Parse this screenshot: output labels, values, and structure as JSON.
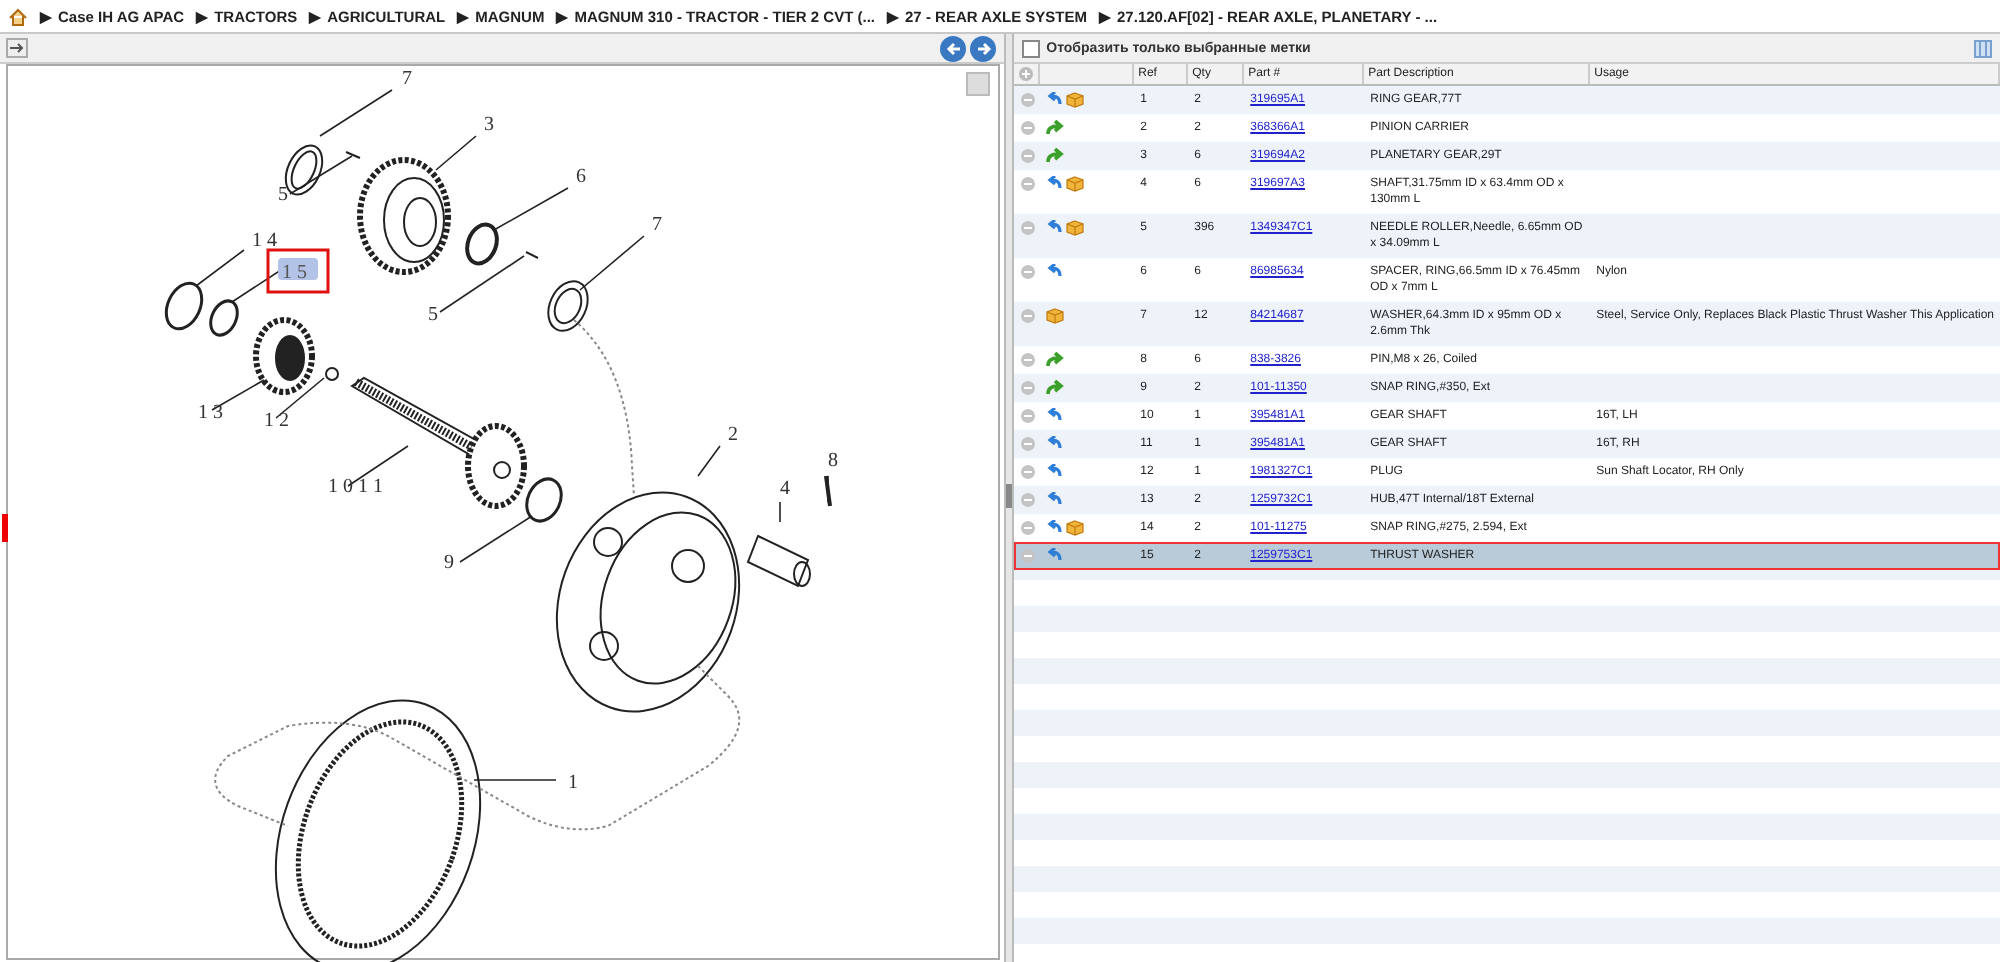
{
  "breadcrumb": {
    "separator": "▶",
    "items": [
      "Case IH AG APAC",
      "TRACTORS",
      "AGRICULTURAL",
      "MAGNUM",
      "MAGNUM 310 - TRACTOR - TIER 2 CVT (...",
      "27 - REAR AXLE SYSTEM",
      "27.120.AF[02] - REAR AXLE, PLANETARY - ..."
    ]
  },
  "diagram": {
    "callouts": [
      {
        "label": "7",
        "selected": false
      },
      {
        "label": "3",
        "selected": false
      },
      {
        "label": "5",
        "selected": false
      },
      {
        "label": "6",
        "selected": false
      },
      {
        "label": "1 4",
        "selected": false
      },
      {
        "label": "1 5",
        "selected": true
      },
      {
        "label": "7",
        "selected": false
      },
      {
        "label": "5",
        "selected": false
      },
      {
        "label": "1 3",
        "selected": false
      },
      {
        "label": "1 2",
        "selected": false
      },
      {
        "label": "1 0 1 1",
        "selected": false
      },
      {
        "label": "2",
        "selected": false
      },
      {
        "label": "8",
        "selected": false
      },
      {
        "label": "4",
        "selected": false
      },
      {
        "label": "9",
        "selected": false
      },
      {
        "label": "1",
        "selected": false
      }
    ]
  },
  "filter": {
    "label": "Отобразить только выбранные метки",
    "checked": false
  },
  "table": {
    "columns": [
      "Ref",
      "Qty",
      "Part #",
      "Part Description",
      "Usage"
    ],
    "rows": [
      {
        "ref": "1",
        "qty": "2",
        "part": "319695A1",
        "description": "RING GEAR,77T",
        "kind": "back",
        "stock": true,
        "selected": false
      },
      {
        "ref": "2",
        "qty": "2",
        "part": "368366A1",
        "description": "PINION CARRIER",
        "kind": "forward",
        "stock": false,
        "selected": false
      },
      {
        "ref": "3",
        "qty": "6",
        "part": "319694A2",
        "description": "PLANETARY GEAR,29T",
        "kind": "forward",
        "stock": false,
        "selected": false
      },
      {
        "ref": "4",
        "qty": "6",
        "part": "319697A3",
        "description": "SHAFT,31.75mm ID x 63.4mm OD x 130mm L",
        "kind": "back",
        "stock": true,
        "selected": false
      },
      {
        "ref": "5",
        "qty": "396",
        "part": "1349347C1",
        "description": "NEEDLE ROLLER,Needle, 6.65mm OD x 34.09mm L",
        "kind": "back",
        "stock": true,
        "selected": false
      },
      {
        "ref": "6",
        "qty": "6",
        "part": "86985634",
        "description": "SPACER, RING,66.5mm ID x 76.45mm OD x 7mm L",
        "usage": "Nylon",
        "kind": "back",
        "stock": false,
        "selected": false
      },
      {
        "ref": "7",
        "qty": "12",
        "part": "84214687",
        "description": "WASHER,64.3mm ID x 95mm OD x 2.6mm Thk",
        "usage": "Steel, Service Only, Replaces Black Plastic Thrust Washer This Application",
        "kind": "none",
        "stock": true,
        "selected": false
      },
      {
        "ref": "8",
        "qty": "6",
        "part": "838-3826",
        "description": "PIN,M8 x 26, Coiled",
        "kind": "forward",
        "stock": false,
        "selected": false
      },
      {
        "ref": "9",
        "qty": "2",
        "part": "101-11350",
        "description": "SNAP RING,#350, Ext",
        "kind": "forward",
        "stock": false,
        "selected": false
      },
      {
        "ref": "10",
        "qty": "1",
        "part": "395481A1",
        "description": "GEAR SHAFT",
        "usage": "16T, LH",
        "kind": "back",
        "stock": false,
        "selected": false
      },
      {
        "ref": "11",
        "qty": "1",
        "part": "395481A1",
        "description": "GEAR SHAFT",
        "usage": "16T, RH",
        "kind": "back",
        "stock": false,
        "selected": false
      },
      {
        "ref": "12",
        "qty": "1",
        "part": "1981327C1",
        "description": "PLUG",
        "usage": "Sun Shaft Locator, RH Only",
        "kind": "back",
        "stock": false,
        "selected": false
      },
      {
        "ref": "13",
        "qty": "2",
        "part": "1259732C1",
        "description": "HUB,47T Internal/18T External",
        "kind": "back",
        "stock": false,
        "selected": false
      },
      {
        "ref": "14",
        "qty": "2",
        "part": "101-11275",
        "description": "SNAP RING,#275, 2.594, Ext",
        "kind": "back",
        "stock": true,
        "selected": false
      },
      {
        "ref": "15",
        "qty": "2",
        "part": "1259753C1",
        "description": "THRUST WASHER",
        "kind": "back",
        "stock": false,
        "selected": true
      }
    ]
  }
}
